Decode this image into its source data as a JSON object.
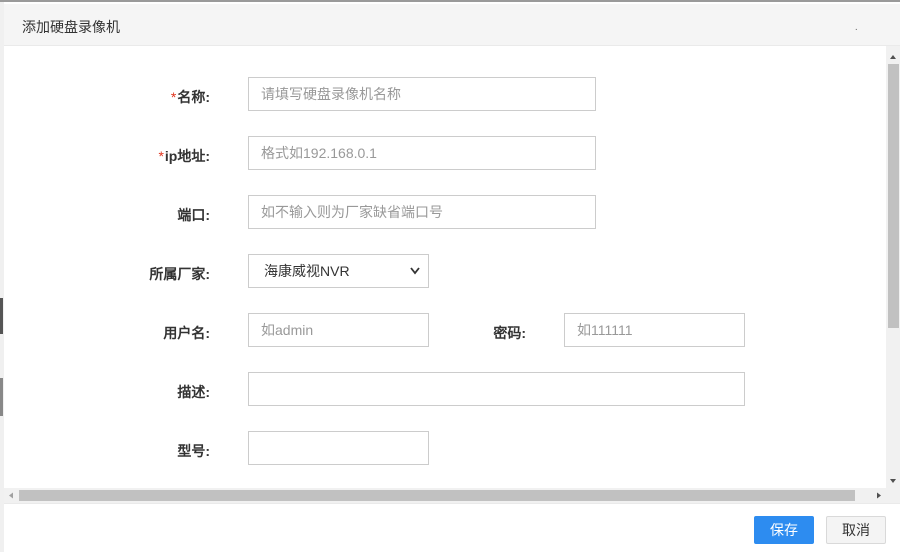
{
  "dialog": {
    "title": "添加硬盘录像机"
  },
  "form": {
    "name": {
      "label": "名称:",
      "required": true,
      "placeholder": "请填写硬盘录像机名称",
      "value": ""
    },
    "ip": {
      "label": "ip地址:",
      "required": true,
      "placeholder": "格式如192.168.0.1",
      "value": ""
    },
    "port": {
      "label": "端口:",
      "required": false,
      "placeholder": "如不输入则为厂家缺省端口号",
      "value": ""
    },
    "vendor": {
      "label": "所属厂家:",
      "selected": "海康威视NVR"
    },
    "username": {
      "label": "用户名:",
      "placeholder": "如admin",
      "value": ""
    },
    "password": {
      "label": "密码:",
      "placeholder": "如111111",
      "value": ""
    },
    "description": {
      "label": "描述:",
      "placeholder": "",
      "value": ""
    },
    "model": {
      "label": "型号:",
      "placeholder": "",
      "value": ""
    }
  },
  "footer": {
    "save_label": "保存",
    "cancel_label": "取消"
  },
  "required_mark": "*",
  "colors": {
    "primary": "#2d8cf0",
    "required": "#e0341d"
  }
}
